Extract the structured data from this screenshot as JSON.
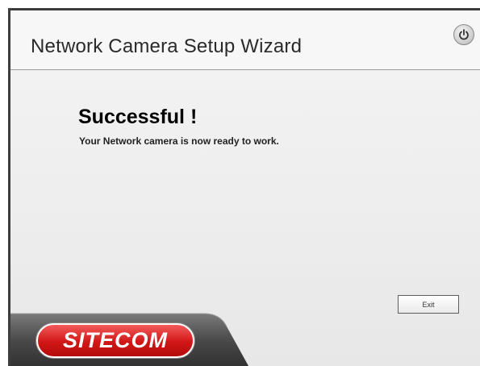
{
  "window": {
    "title": "Network Camera Setup Wizard"
  },
  "icons": {
    "power": "power-icon"
  },
  "content": {
    "headline": "Successful !",
    "message": "Your Network camera is now ready to work."
  },
  "actions": {
    "exit_label": "Exit"
  },
  "branding": {
    "logo_text": "SITECOM",
    "logo_color": "#d11616"
  }
}
